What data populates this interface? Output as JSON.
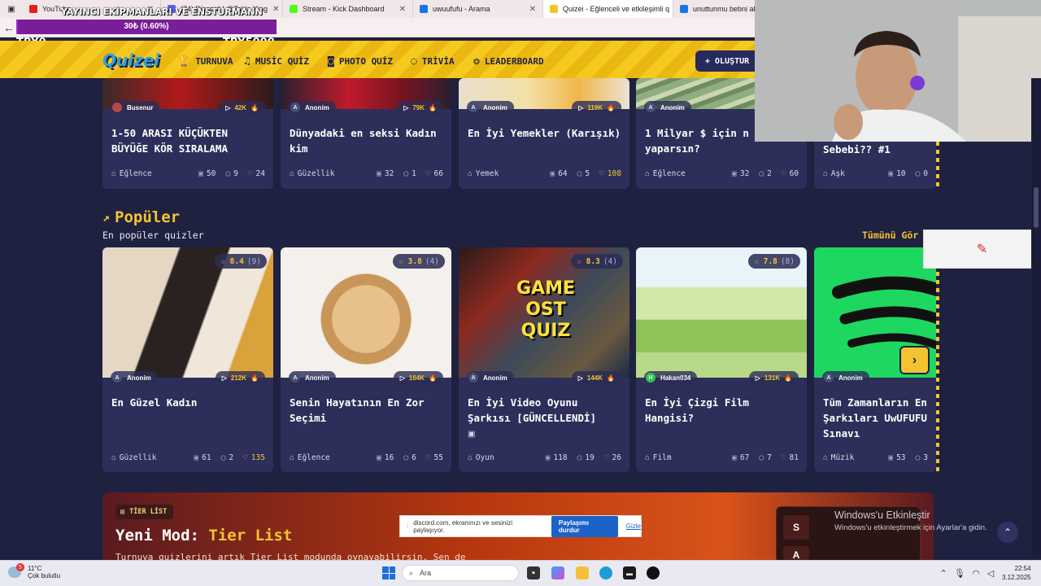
{
  "browser": {
    "tabs": [
      {
        "label": "YouTube",
        "color": "#e62117"
      },
      {
        "label": "(74) Discord | @Takla King",
        "color": "#5865f2"
      },
      {
        "label": "Stream - Kick Dashboard",
        "color": "#53fc18"
      },
      {
        "label": "uwuufufu - Arama",
        "color": "#1a73e8"
      },
      {
        "label": "Quizei - Eğlenceli ve etkileşimli q",
        "color": "#f4c430"
      },
      {
        "label": "unuttunmu bebni akon",
        "color": "#1a73e8"
      }
    ]
  },
  "overlay": {
    "title": "YAYINCI EKİPMANLARI VE ENSTURMANN",
    "progress_label": "30₺ (0.60%)",
    "progress_fraction": 0.006,
    "left_label": "TRY0",
    "right_label": "TRY5000"
  },
  "header": {
    "logo": "Quizei",
    "nav": [
      "TURNUVA",
      "MUSİC QUİZ",
      "PHOTO QUİZ",
      "TRİVİA",
      "LEADERBOARD"
    ],
    "create_label": "+ OLUŞTUR"
  },
  "top_cards": [
    {
      "author": "Busenur",
      "plays": "42K",
      "title": "1-50 ARASI KÜÇÜKTEN BÜYÜĞE KÖR SIRALAMA",
      "category": "Eğlence",
      "questions": "50",
      "comments": "9",
      "likes": "24"
    },
    {
      "author": "Anonim",
      "plays": "79K",
      "title": "Dünyadaki en seksi Kadın kim",
      "category": "Güzellik",
      "questions": "32",
      "comments": "1",
      "likes": "66"
    },
    {
      "author": "Anonim",
      "plays": "119K",
      "title": "En İyi Yemekler (Karışık)",
      "category": "Yemek",
      "questions": "64",
      "comments": "5",
      "likes": "108"
    },
    {
      "author": "Anonim",
      "plays": "",
      "title": "1 Milyar $ için n yaparsın?",
      "category": "Eğlence",
      "questions": "32",
      "comments": "2",
      "likes": "60"
    },
    {
      "author": "",
      "plays": "",
      "title": "Sebebi?? #1",
      "category": "Aşk",
      "questions": "10",
      "comments": "0",
      "likes": ""
    }
  ],
  "popular": {
    "title": "Popüler",
    "subtitle": "En popüler quizler",
    "see_all": "Tümünü Gör"
  },
  "popular_cards": [
    {
      "rating": "8.4",
      "count": "(9)",
      "author": "Anonim",
      "plays": "212K",
      "title": "En Güzel Kadın",
      "category": "Güzellik",
      "questions": "61",
      "comments": "2",
      "likes": "135"
    },
    {
      "rating": "3.8",
      "count": "(4)",
      "author": "Anonim",
      "plays": "164K",
      "title": "Senin Hayatının En Zor Seçimi",
      "category": "Eğlence",
      "questions": "16",
      "comments": "6",
      "likes": "55"
    },
    {
      "rating": "8.3",
      "count": "(4)",
      "author": "Anonim",
      "plays": "144K",
      "title": "En İyi Video Oyunu Şarkısı [GÜNCELLENDİ]",
      "category": "Oyun",
      "questions": "118",
      "comments": "19",
      "likes": "26",
      "thumb_text": "GAME OST QUIZ"
    },
    {
      "rating": "7.8",
      "count": "(8)",
      "author": "Hakan034",
      "plays": "131K",
      "title": "En İyi Çizgi Film Hangisi?",
      "category": "Film",
      "questions": "67",
      "comments": "7",
      "likes": "81"
    },
    {
      "rating": "",
      "count": "",
      "author": "Anonim",
      "plays": "",
      "title": "Tüm Zamanların En Şarkıları UwUFUFU Sınavı",
      "category": "Müzik",
      "questions": "53",
      "comments": "3",
      "likes": ""
    }
  ],
  "tier": {
    "badge": "TİER LİST",
    "title_prefix": "Yeni Mod: ",
    "title_highlight": "Tier List",
    "description": "Turnuva quizlerini artık Tier List modunda oynayabilirsin. Sen de",
    "rows": [
      "S",
      "A"
    ]
  },
  "watermark": {
    "line1": "Windows'u Etkinleştir",
    "line2": "Windows'u etkinleştirmek için Ayarlar'a gidin."
  },
  "share_bar": {
    "text": "discord.com, ekranınızı ve sesinizi paylaşıyor.",
    "stop": "Paylaşımı durdur",
    "hide": "Gizle"
  },
  "taskbar": {
    "weather_temp": "11°C",
    "weather_desc": "Çok bulutlu",
    "weather_badge": "5",
    "search_placeholder": "Ara",
    "time": "22:54",
    "date": "3.12.2025"
  },
  "colors": {
    "accent": "#f4c430",
    "bg": "#1f2140",
    "card": "#2d2f5a"
  }
}
